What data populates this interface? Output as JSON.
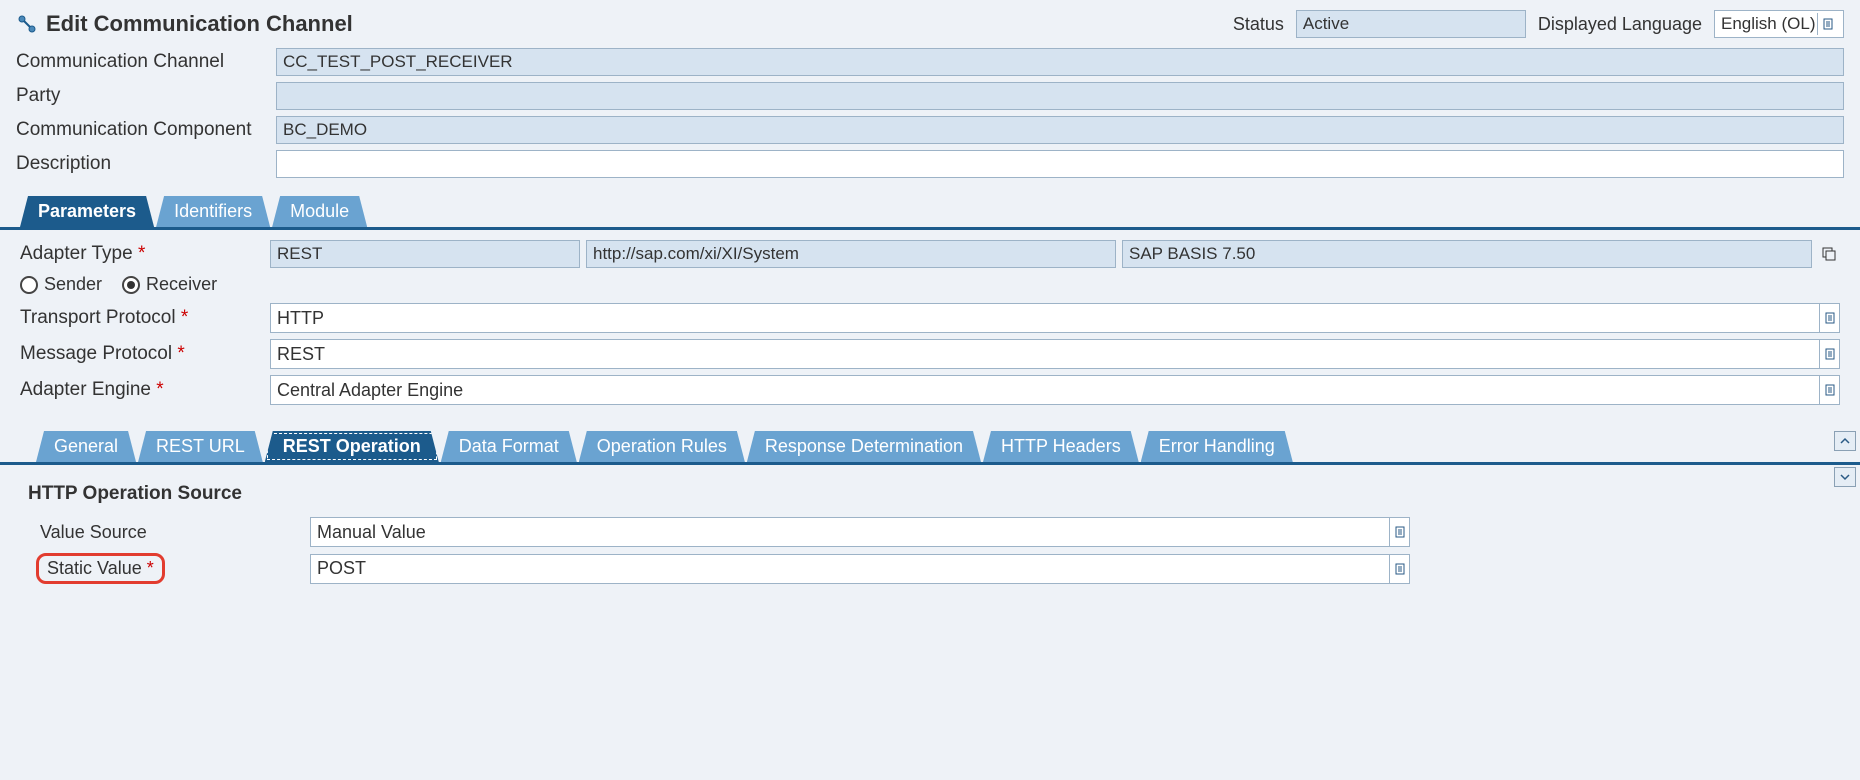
{
  "header": {
    "title": "Edit Communication Channel",
    "status_label": "Status",
    "status_value": "Active",
    "displayed_language_label": "Displayed Language",
    "displayed_language_value": "English (OL)"
  },
  "top_form": {
    "comm_channel_label": "Communication Channel",
    "comm_channel_value": "CC_TEST_POST_RECEIVER",
    "party_label": "Party",
    "party_value": "",
    "comm_component_label": "Communication Component",
    "comm_component_value": "BC_DEMO",
    "description_label": "Description",
    "description_value": ""
  },
  "main_tabs": [
    "Parameters",
    "Identifiers",
    "Module"
  ],
  "main_tab_active": 0,
  "parameters": {
    "adapter_type_label": "Adapter Type",
    "adapter_type_value": "REST",
    "adapter_namespace": "http://sap.com/xi/XI/System",
    "adapter_swcv": "SAP BASIS 7.50",
    "direction_sender": "Sender",
    "direction_receiver": "Receiver",
    "direction_selected": "Receiver",
    "transport_protocol_label": "Transport Protocol",
    "transport_protocol_value": "HTTP",
    "message_protocol_label": "Message Protocol",
    "message_protocol_value": "REST",
    "adapter_engine_label": "Adapter Engine",
    "adapter_engine_value": "Central Adapter Engine"
  },
  "sub_tabs": [
    "General",
    "REST URL",
    "REST Operation",
    "Data Format",
    "Operation Rules",
    "Response Determination",
    "HTTP Headers",
    "Error Handling"
  ],
  "sub_tab_active": 2,
  "rest_operation": {
    "section_title": "HTTP Operation Source",
    "value_source_label": "Value Source",
    "value_source_value": "Manual Value",
    "static_value_label": "Static Value",
    "static_value_value": "POST"
  }
}
